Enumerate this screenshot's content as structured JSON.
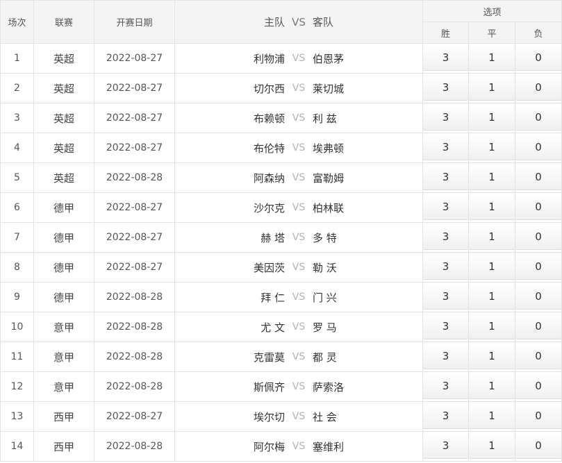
{
  "header": {
    "col_index": "场次",
    "col_league": "联赛",
    "col_date": "开赛日期",
    "col_home": "主队",
    "col_vs": "VS",
    "col_away": "客队",
    "col_options": "选项",
    "opt_win": "胜",
    "opt_draw": "平",
    "opt_lose": "负"
  },
  "vs_label": "VS",
  "rows": [
    {
      "index": "1",
      "league": "英超",
      "date": "2022-08-27",
      "home": "利物浦",
      "away": "伯恩茅",
      "win": "3",
      "draw": "1",
      "lose": "0"
    },
    {
      "index": "2",
      "league": "英超",
      "date": "2022-08-27",
      "home": "切尔西",
      "away": "莱切城",
      "win": "3",
      "draw": "1",
      "lose": "0"
    },
    {
      "index": "3",
      "league": "英超",
      "date": "2022-08-27",
      "home": "布赖顿",
      "away": "利 兹",
      "win": "3",
      "draw": "1",
      "lose": "0"
    },
    {
      "index": "4",
      "league": "英超",
      "date": "2022-08-27",
      "home": "布伦特",
      "away": "埃弗顿",
      "win": "3",
      "draw": "1",
      "lose": "0"
    },
    {
      "index": "5",
      "league": "英超",
      "date": "2022-08-28",
      "home": "阿森纳",
      "away": "富勒姆",
      "win": "3",
      "draw": "1",
      "lose": "0"
    },
    {
      "index": "6",
      "league": "德甲",
      "date": "2022-08-27",
      "home": "沙尔克",
      "away": "柏林联",
      "win": "3",
      "draw": "1",
      "lose": "0"
    },
    {
      "index": "7",
      "league": "德甲",
      "date": "2022-08-27",
      "home": "赫 塔",
      "away": "多 特",
      "win": "3",
      "draw": "1",
      "lose": "0"
    },
    {
      "index": "8",
      "league": "德甲",
      "date": "2022-08-27",
      "home": "美因茨",
      "away": "勒 沃",
      "win": "3",
      "draw": "1",
      "lose": "0"
    },
    {
      "index": "9",
      "league": "德甲",
      "date": "2022-08-28",
      "home": "拜 仁",
      "away": "门 兴",
      "win": "3",
      "draw": "1",
      "lose": "0"
    },
    {
      "index": "10",
      "league": "意甲",
      "date": "2022-08-28",
      "home": "尤 文",
      "away": "罗 马",
      "win": "3",
      "draw": "1",
      "lose": "0"
    },
    {
      "index": "11",
      "league": "意甲",
      "date": "2022-08-28",
      "home": "克雷莫",
      "away": "都 灵",
      "win": "3",
      "draw": "1",
      "lose": "0"
    },
    {
      "index": "12",
      "league": "意甲",
      "date": "2022-08-28",
      "home": "斯佩齐",
      "away": "萨索洛",
      "win": "3",
      "draw": "1",
      "lose": "0"
    },
    {
      "index": "13",
      "league": "西甲",
      "date": "2022-08-27",
      "home": "埃尔切",
      "away": "社 会",
      "win": "3",
      "draw": "1",
      "lose": "0"
    },
    {
      "index": "14",
      "league": "西甲",
      "date": "2022-08-28",
      "home": "阿尔梅",
      "away": "塞维利",
      "win": "3",
      "draw": "1",
      "lose": "0"
    }
  ]
}
